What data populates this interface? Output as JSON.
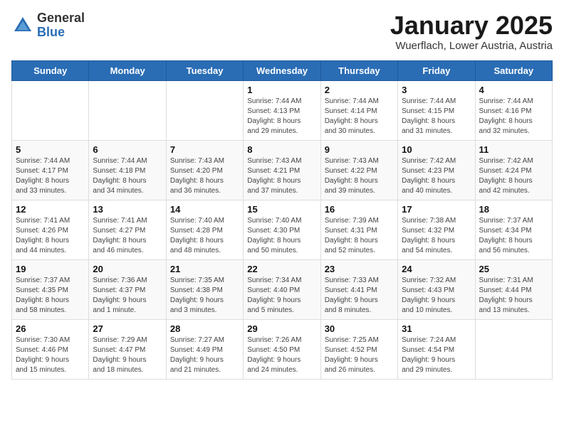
{
  "logo": {
    "general": "General",
    "blue": "Blue"
  },
  "title": "January 2025",
  "location": "Wuerflach, Lower Austria, Austria",
  "days_header": [
    "Sunday",
    "Monday",
    "Tuesday",
    "Wednesday",
    "Thursday",
    "Friday",
    "Saturday"
  ],
  "weeks": [
    [
      {
        "day": "",
        "info": ""
      },
      {
        "day": "",
        "info": ""
      },
      {
        "day": "",
        "info": ""
      },
      {
        "day": "1",
        "info": "Sunrise: 7:44 AM\nSunset: 4:13 PM\nDaylight: 8 hours\nand 29 minutes."
      },
      {
        "day": "2",
        "info": "Sunrise: 7:44 AM\nSunset: 4:14 PM\nDaylight: 8 hours\nand 30 minutes."
      },
      {
        "day": "3",
        "info": "Sunrise: 7:44 AM\nSunset: 4:15 PM\nDaylight: 8 hours\nand 31 minutes."
      },
      {
        "day": "4",
        "info": "Sunrise: 7:44 AM\nSunset: 4:16 PM\nDaylight: 8 hours\nand 32 minutes."
      }
    ],
    [
      {
        "day": "5",
        "info": "Sunrise: 7:44 AM\nSunset: 4:17 PM\nDaylight: 8 hours\nand 33 minutes."
      },
      {
        "day": "6",
        "info": "Sunrise: 7:44 AM\nSunset: 4:18 PM\nDaylight: 8 hours\nand 34 minutes."
      },
      {
        "day": "7",
        "info": "Sunrise: 7:43 AM\nSunset: 4:20 PM\nDaylight: 8 hours\nand 36 minutes."
      },
      {
        "day": "8",
        "info": "Sunrise: 7:43 AM\nSunset: 4:21 PM\nDaylight: 8 hours\nand 37 minutes."
      },
      {
        "day": "9",
        "info": "Sunrise: 7:43 AM\nSunset: 4:22 PM\nDaylight: 8 hours\nand 39 minutes."
      },
      {
        "day": "10",
        "info": "Sunrise: 7:42 AM\nSunset: 4:23 PM\nDaylight: 8 hours\nand 40 minutes."
      },
      {
        "day": "11",
        "info": "Sunrise: 7:42 AM\nSunset: 4:24 PM\nDaylight: 8 hours\nand 42 minutes."
      }
    ],
    [
      {
        "day": "12",
        "info": "Sunrise: 7:41 AM\nSunset: 4:26 PM\nDaylight: 8 hours\nand 44 minutes."
      },
      {
        "day": "13",
        "info": "Sunrise: 7:41 AM\nSunset: 4:27 PM\nDaylight: 8 hours\nand 46 minutes."
      },
      {
        "day": "14",
        "info": "Sunrise: 7:40 AM\nSunset: 4:28 PM\nDaylight: 8 hours\nand 48 minutes."
      },
      {
        "day": "15",
        "info": "Sunrise: 7:40 AM\nSunset: 4:30 PM\nDaylight: 8 hours\nand 50 minutes."
      },
      {
        "day": "16",
        "info": "Sunrise: 7:39 AM\nSunset: 4:31 PM\nDaylight: 8 hours\nand 52 minutes."
      },
      {
        "day": "17",
        "info": "Sunrise: 7:38 AM\nSunset: 4:32 PM\nDaylight: 8 hours\nand 54 minutes."
      },
      {
        "day": "18",
        "info": "Sunrise: 7:37 AM\nSunset: 4:34 PM\nDaylight: 8 hours\nand 56 minutes."
      }
    ],
    [
      {
        "day": "19",
        "info": "Sunrise: 7:37 AM\nSunset: 4:35 PM\nDaylight: 8 hours\nand 58 minutes."
      },
      {
        "day": "20",
        "info": "Sunrise: 7:36 AM\nSunset: 4:37 PM\nDaylight: 9 hours\nand 1 minute."
      },
      {
        "day": "21",
        "info": "Sunrise: 7:35 AM\nSunset: 4:38 PM\nDaylight: 9 hours\nand 3 minutes."
      },
      {
        "day": "22",
        "info": "Sunrise: 7:34 AM\nSunset: 4:40 PM\nDaylight: 9 hours\nand 5 minutes."
      },
      {
        "day": "23",
        "info": "Sunrise: 7:33 AM\nSunset: 4:41 PM\nDaylight: 9 hours\nand 8 minutes."
      },
      {
        "day": "24",
        "info": "Sunrise: 7:32 AM\nSunset: 4:43 PM\nDaylight: 9 hours\nand 10 minutes."
      },
      {
        "day": "25",
        "info": "Sunrise: 7:31 AM\nSunset: 4:44 PM\nDaylight: 9 hours\nand 13 minutes."
      }
    ],
    [
      {
        "day": "26",
        "info": "Sunrise: 7:30 AM\nSunset: 4:46 PM\nDaylight: 9 hours\nand 15 minutes."
      },
      {
        "day": "27",
        "info": "Sunrise: 7:29 AM\nSunset: 4:47 PM\nDaylight: 9 hours\nand 18 minutes."
      },
      {
        "day": "28",
        "info": "Sunrise: 7:27 AM\nSunset: 4:49 PM\nDaylight: 9 hours\nand 21 minutes."
      },
      {
        "day": "29",
        "info": "Sunrise: 7:26 AM\nSunset: 4:50 PM\nDaylight: 9 hours\nand 24 minutes."
      },
      {
        "day": "30",
        "info": "Sunrise: 7:25 AM\nSunset: 4:52 PM\nDaylight: 9 hours\nand 26 minutes."
      },
      {
        "day": "31",
        "info": "Sunrise: 7:24 AM\nSunset: 4:54 PM\nDaylight: 9 hours\nand 29 minutes."
      },
      {
        "day": "",
        "info": ""
      }
    ]
  ]
}
